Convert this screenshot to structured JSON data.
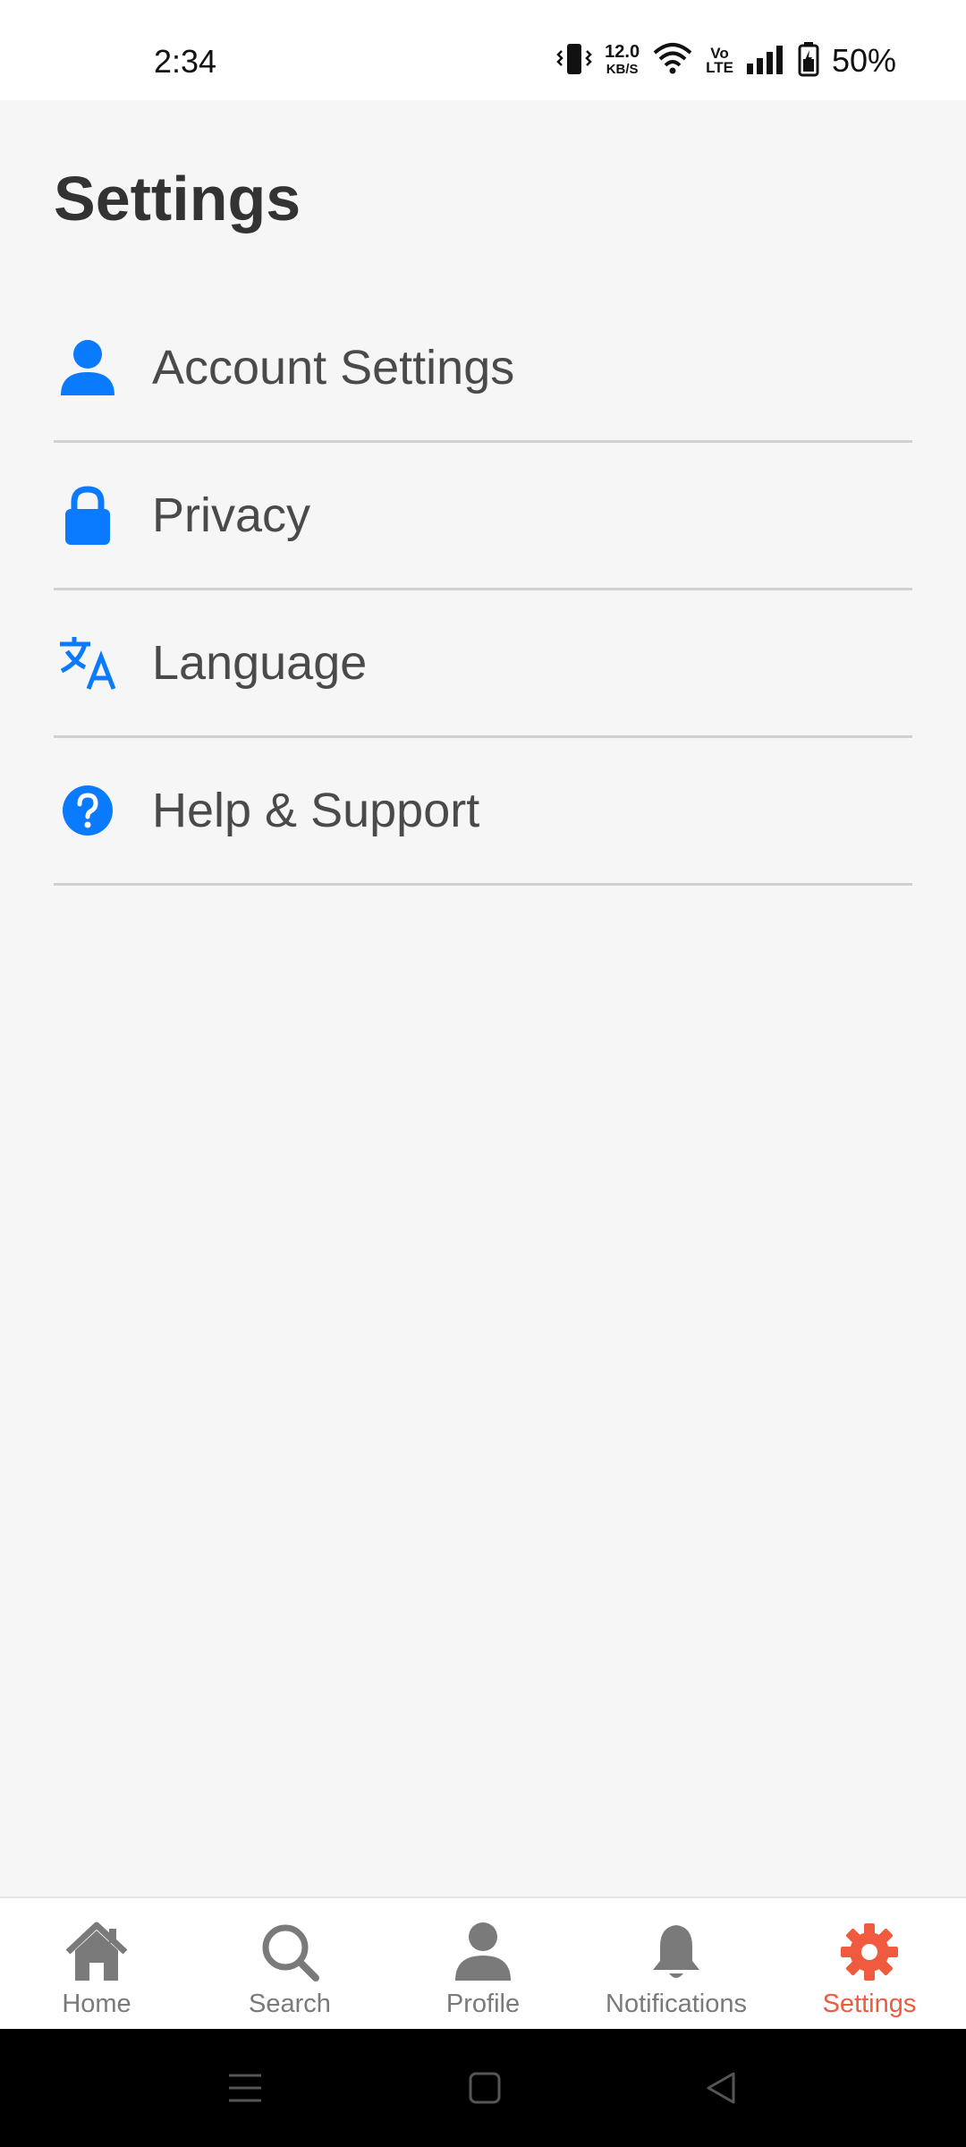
{
  "status_bar": {
    "time": "2:34",
    "speed_value": "12.0",
    "speed_unit": "KB/S",
    "volte_top": "Vo",
    "volte_bottom": "LTE",
    "battery_percent": "50%"
  },
  "header": {
    "title": "Settings"
  },
  "settings_items": [
    {
      "label": "Account Settings",
      "icon": "person-icon"
    },
    {
      "label": "Privacy",
      "icon": "lock-icon"
    },
    {
      "label": "Language",
      "icon": "translate-icon"
    },
    {
      "label": "Help & Support",
      "icon": "help-circle-icon"
    }
  ],
  "bottom_nav": [
    {
      "label": "Home",
      "icon": "home-icon"
    },
    {
      "label": "Search",
      "icon": "search-icon"
    },
    {
      "label": "Profile",
      "icon": "person-icon"
    },
    {
      "label": "Notifications",
      "icon": "bell-icon"
    },
    {
      "label": "Settings",
      "icon": "gear-icon",
      "active": true
    }
  ],
  "colors": {
    "accent_blue": "#0a7aff",
    "active_nav": "#f05a3f",
    "inactive_nav": "#7a7a7a",
    "background": "#f6f6f6"
  }
}
